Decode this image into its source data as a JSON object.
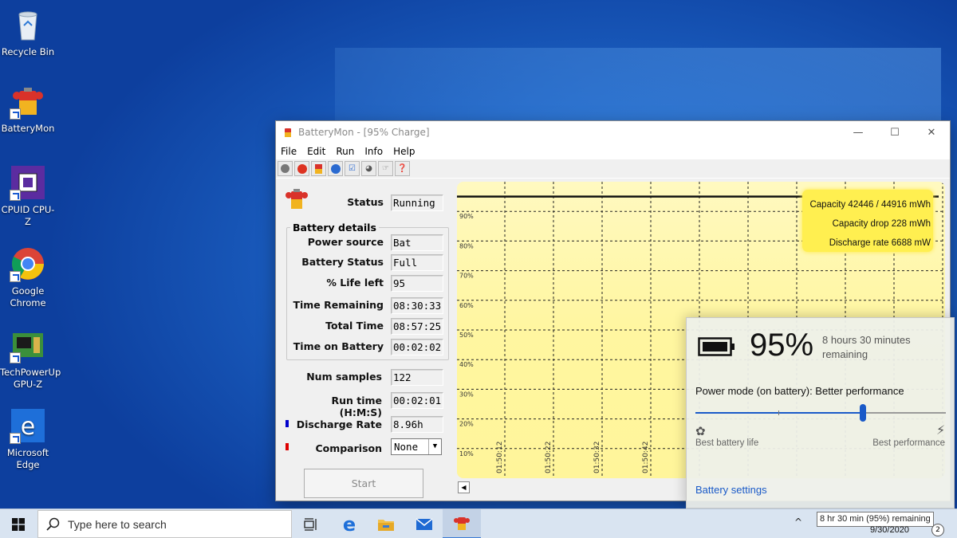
{
  "desktop": {
    "icons": [
      {
        "label": "Recycle Bin",
        "icon": "recycle-bin-icon"
      },
      {
        "label": "BatteryMon",
        "icon": "batterymon-icon"
      },
      {
        "label": "CPUID CPU-Z",
        "icon": "cpuz-icon"
      },
      {
        "label": "Google Chrome",
        "icon": "chrome-icon"
      },
      {
        "label": "TechPowerUp GPU-Z",
        "icon": "gpuz-icon"
      },
      {
        "label": "Microsoft Edge",
        "icon": "edge-icon"
      }
    ]
  },
  "window": {
    "title": "BatteryMon - [95% Charge]",
    "menu": [
      "File",
      "Edit",
      "Run",
      "Info",
      "Help"
    ],
    "status_label": "Status",
    "status_value": "Running",
    "group_title": "Battery details",
    "details": [
      {
        "label": "Power source",
        "value": "Bat"
      },
      {
        "label": "Battery Status",
        "value": "Full"
      },
      {
        "label": "% Life left",
        "value": "95"
      },
      {
        "label": "Time Remaining",
        "value": "08:30:33"
      },
      {
        "label": "Total Time",
        "value": "08:57:25"
      },
      {
        "label": "Time on Battery",
        "value": "00:02:02"
      }
    ],
    "num_samples_label": "Num samples",
    "num_samples_value": "122",
    "run_time_label": "Run time (H:M:S)",
    "run_time_value": "00:02:01",
    "discharge_label": "Discharge Rate",
    "discharge_value": "8.96h",
    "discharge_color": "#0000cc",
    "comparison_label": "Comparison",
    "comparison_value": "None",
    "comparison_color": "#dd0000",
    "start_label": "Start"
  },
  "chart_data": {
    "type": "line",
    "y_tick_labels": [
      "90%",
      "80%",
      "70%",
      "60%",
      "50%",
      "40%",
      "30%",
      "20%",
      "10%"
    ],
    "x_tick_labels": [
      "01:50:12",
      "01:50:22",
      "01:50:32",
      "01:50:42"
    ],
    "series": [
      {
        "values": [
          95,
          95,
          95,
          95,
          95,
          95,
          95,
          95,
          95,
          95,
          95
        ]
      }
    ],
    "ylim": [
      0,
      100
    ],
    "grid": true,
    "info": [
      "Capacity 42446 / 44916 mWh",
      "Capacity drop 228 mWh",
      "Discharge rate 6688 mW"
    ]
  },
  "flyout": {
    "percent": "95%",
    "remaining_line1": "8 hours 30 minutes",
    "remaining_line2": "remaining",
    "power_mode": "Power mode (on battery): Better performance",
    "slider_level": 0.67,
    "left_label": "Best battery life",
    "right_label": "Best performance",
    "settings_link": "Battery settings"
  },
  "taskbar": {
    "search_placeholder": "Type here to search",
    "tooltip": "8 hr 30 min (95%) remaining",
    "date": "9/30/2020"
  }
}
